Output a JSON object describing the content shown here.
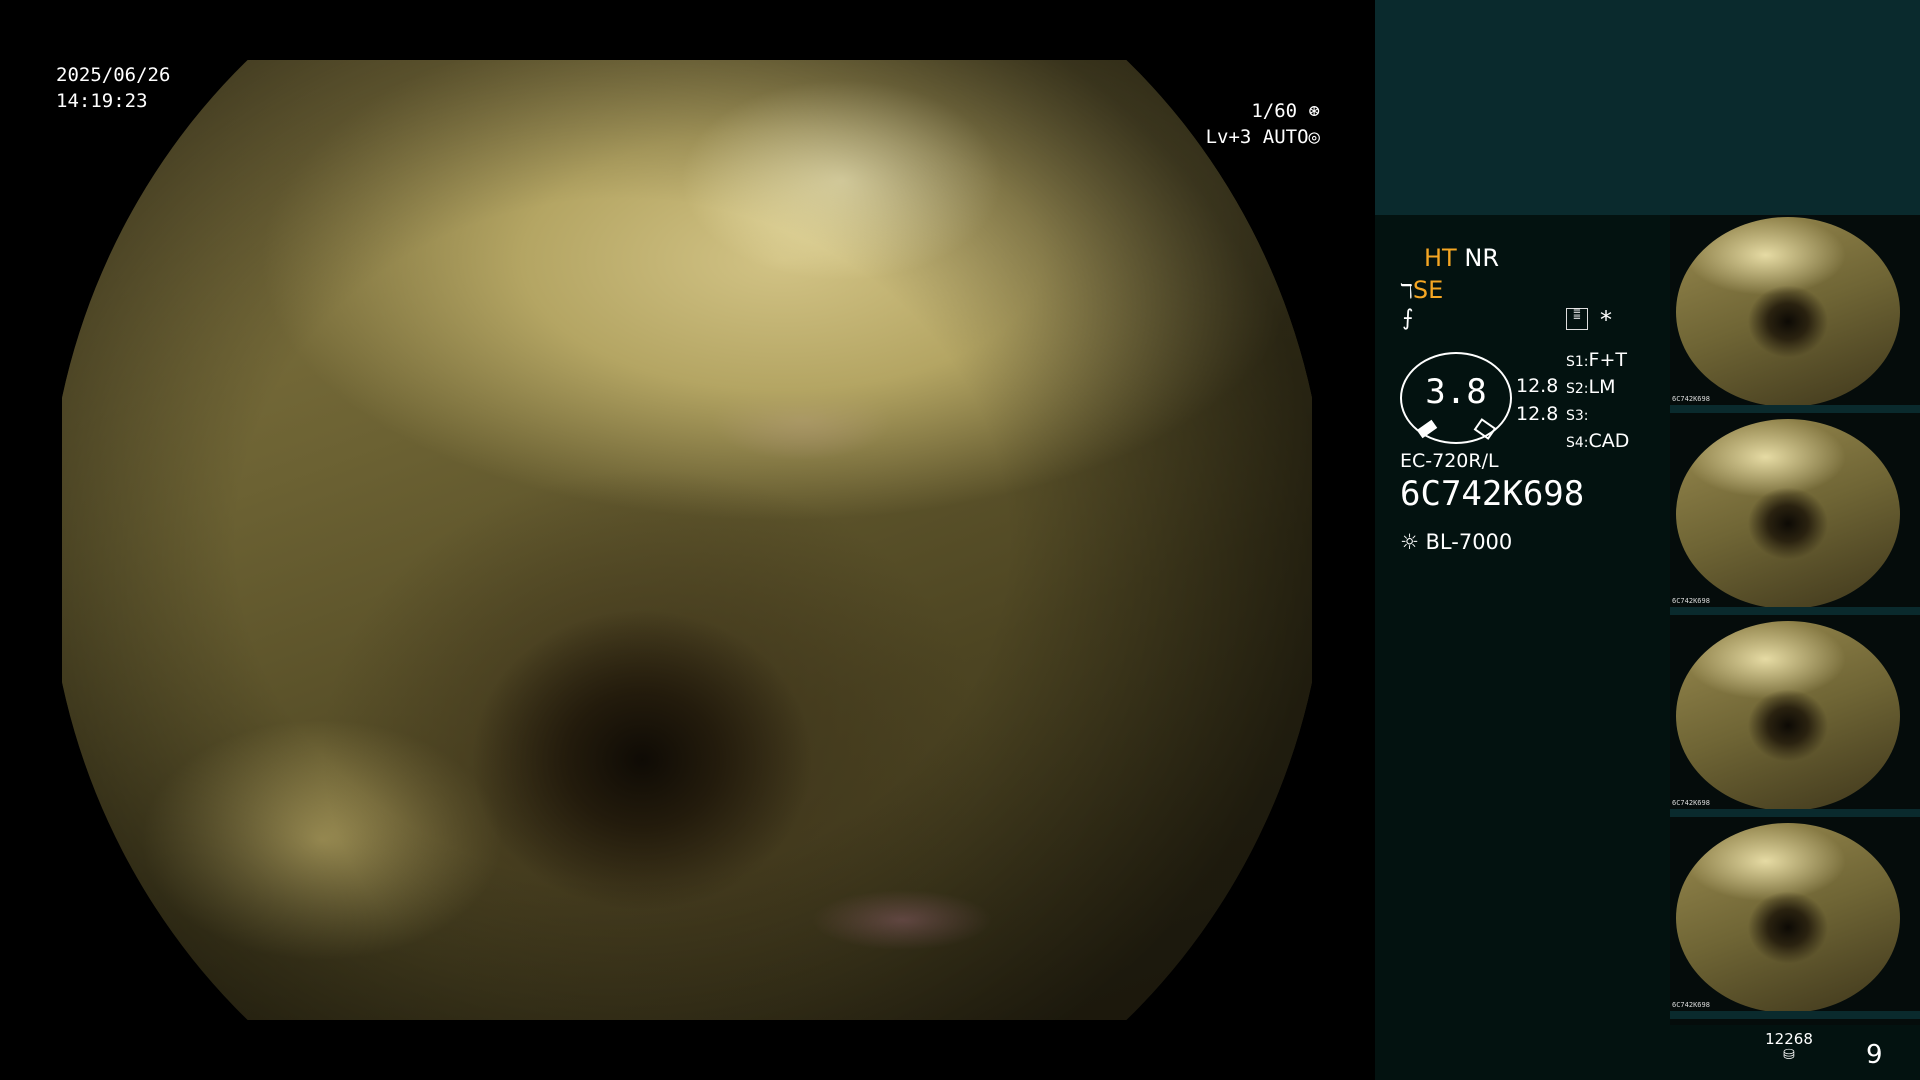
{
  "overlay": {
    "date": "2025/06/26",
    "time": "14:19:23",
    "shutter": "1/60",
    "level": "Lv+3",
    "mode": "AUTO"
  },
  "panel": {
    "ht": "HT",
    "nr": "NR",
    "se": "SE",
    "zoom_value": "3.8",
    "val_top": "12.8",
    "val_bottom": "12.8",
    "scope_model": "EC-720R/L",
    "serial": "6C742K698",
    "light_source": "BL-7000",
    "switches": [
      {
        "key": "S1",
        "value": "F+T"
      },
      {
        "key": "S2",
        "value": "LM"
      },
      {
        "key": "S3",
        "value": ""
      },
      {
        "key": "S4",
        "value": "CAD"
      }
    ]
  },
  "thumbnails": [
    {
      "serial": "6C742K698"
    },
    {
      "serial": "6C742K698"
    },
    {
      "serial": "6C742K698"
    },
    {
      "serial": "6C742K698"
    }
  ],
  "footer": {
    "storage_count": "12268",
    "page": "9"
  },
  "colors": {
    "panel_bg": "#031210",
    "panel_top_bg": "#0a2a2d",
    "accent_orange": "#f5a623"
  }
}
